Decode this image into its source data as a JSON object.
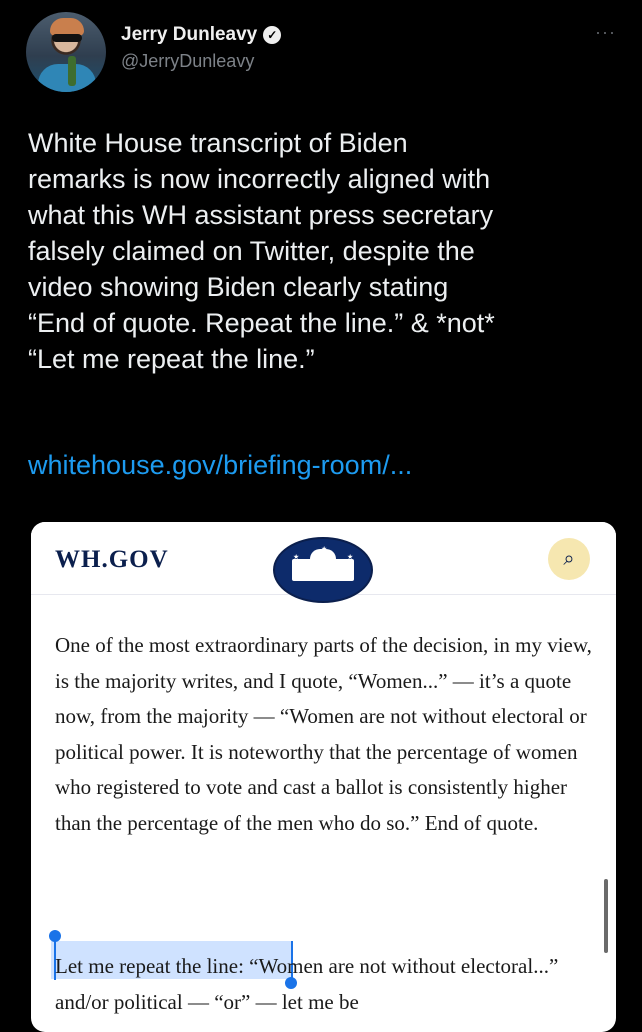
{
  "tweet": {
    "author_name": "Jerry Dunleavy",
    "author_handle": "@JerryDunleavy",
    "verified_icon": "verified-badge",
    "more_icon": "more-horizontal",
    "text": "White House transcript of Biden\nremarks is now incorrectly aligned with\nwhat this WH assistant press secretary\nfalsely claimed on Twitter, despite the\nvideo showing Biden clearly stating\n“End of quote. Repeat the line.” & *not*\n“Let me repeat the line.”",
    "link": "whitehouse.gov/briefing-room/..."
  },
  "card": {
    "site_title": "WH.GOV",
    "search_icon": "search-icon",
    "paragraph": "One of the most extraordinary parts of the decision, in my view, is the majority writes, and I quote, “Women...” — it’s a quote now, from the majority — “Women are not without electoral or political power.  It is noteworthy that the percentage of women who registered to vote and cast a ballot is consistently higher than the percentage of the men who do so.”  End of quote.",
    "selected_text": "Let me repeat the line:",
    "continuation": " “Women are not without electoral...” and/or political — “or” — let me be"
  },
  "colors": {
    "background": "#000000",
    "link": "#1d9bf0",
    "selection": "#cfe2ff",
    "handle": "#1a73e8",
    "navy": "#0b1f4d"
  }
}
